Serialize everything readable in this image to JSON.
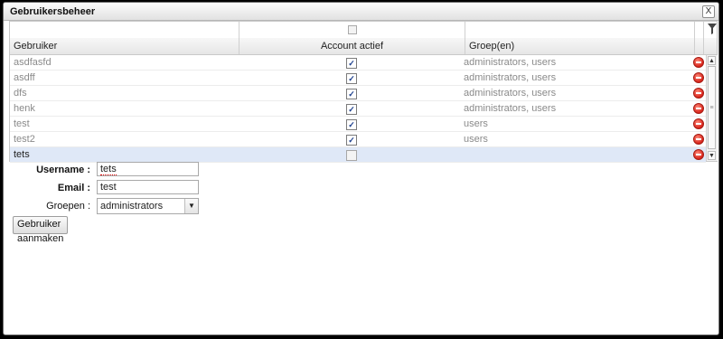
{
  "window": {
    "title": "Gebruikersbeheer",
    "close_label": "X"
  },
  "grid": {
    "columns": [
      "Gebruiker",
      "Account actief",
      "Groep(en)"
    ],
    "rows": [
      {
        "name": "asdfasfd",
        "active": true,
        "groups": "administrators, users"
      },
      {
        "name": "asdff",
        "active": true,
        "groups": "administrators, users"
      },
      {
        "name": "dfs",
        "active": true,
        "groups": "administrators, users"
      },
      {
        "name": "henk",
        "active": true,
        "groups": "administrators, users"
      },
      {
        "name": "test",
        "active": true,
        "groups": "users"
      },
      {
        "name": "test2",
        "active": true,
        "groups": "users"
      },
      {
        "name": "tets",
        "active": false,
        "groups": "",
        "selected": true
      }
    ],
    "check_glyph": "✓"
  },
  "form": {
    "username_label": "Username :",
    "username_value": "tets",
    "email_label": "Email :",
    "email_value": "test",
    "groups_label": "Groepen :",
    "groups_value": "administrators",
    "create_button": "Gebruiker aanmaken"
  },
  "icons": {
    "filter": "filter-icon",
    "delete": "delete-icon",
    "scroll_up": "▲",
    "scroll_down": "▼",
    "dropdown": "▼"
  }
}
